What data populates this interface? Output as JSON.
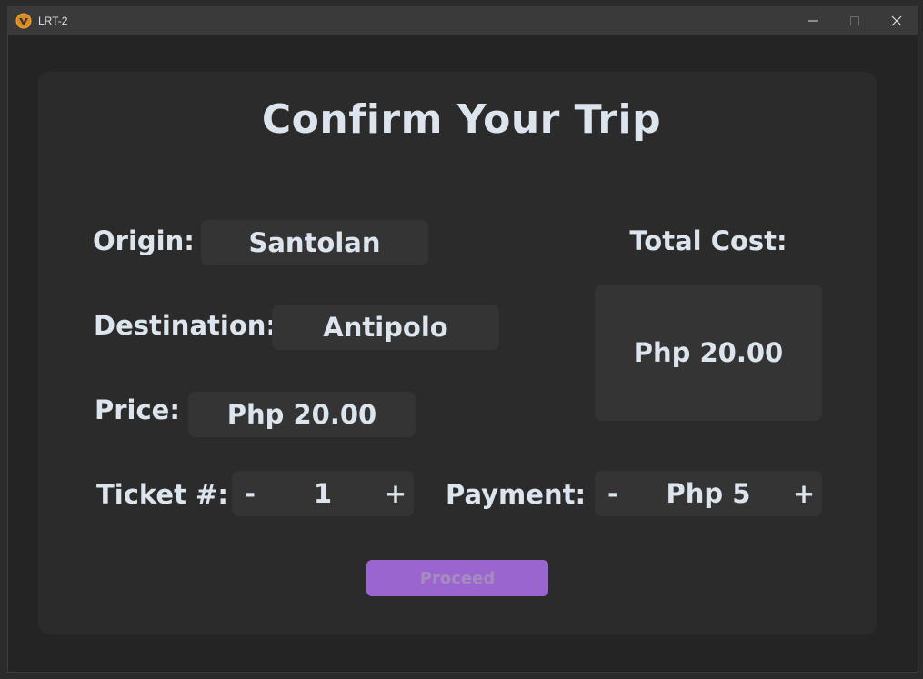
{
  "window": {
    "title": "LRT-2",
    "app_icon": "lrt-logo-icon",
    "controls": [
      "minimize-icon",
      "maximize-icon",
      "close-icon"
    ]
  },
  "page": {
    "title": "Confirm Your Trip"
  },
  "origin": {
    "label": "Origin:",
    "value": "Santolan"
  },
  "destination": {
    "label": "Destination:",
    "value": "Antipolo"
  },
  "price": {
    "label": "Price:",
    "value": "Php 20.00"
  },
  "total_cost": {
    "label": "Total Cost:",
    "value": "Php 20.00"
  },
  "tickets": {
    "label": "Ticket #:",
    "decrement": "-",
    "value": "1",
    "increment": "+"
  },
  "payment": {
    "label": "Payment:",
    "decrement": "-",
    "value": "Php 5",
    "increment": "+"
  },
  "proceed": {
    "label": "Proceed"
  },
  "colors": {
    "window_bg": "#242424",
    "panel_bg": "#2b2b2b",
    "field_bg": "#343434",
    "accent": "#9b65d0",
    "text": "#dce4ee"
  }
}
